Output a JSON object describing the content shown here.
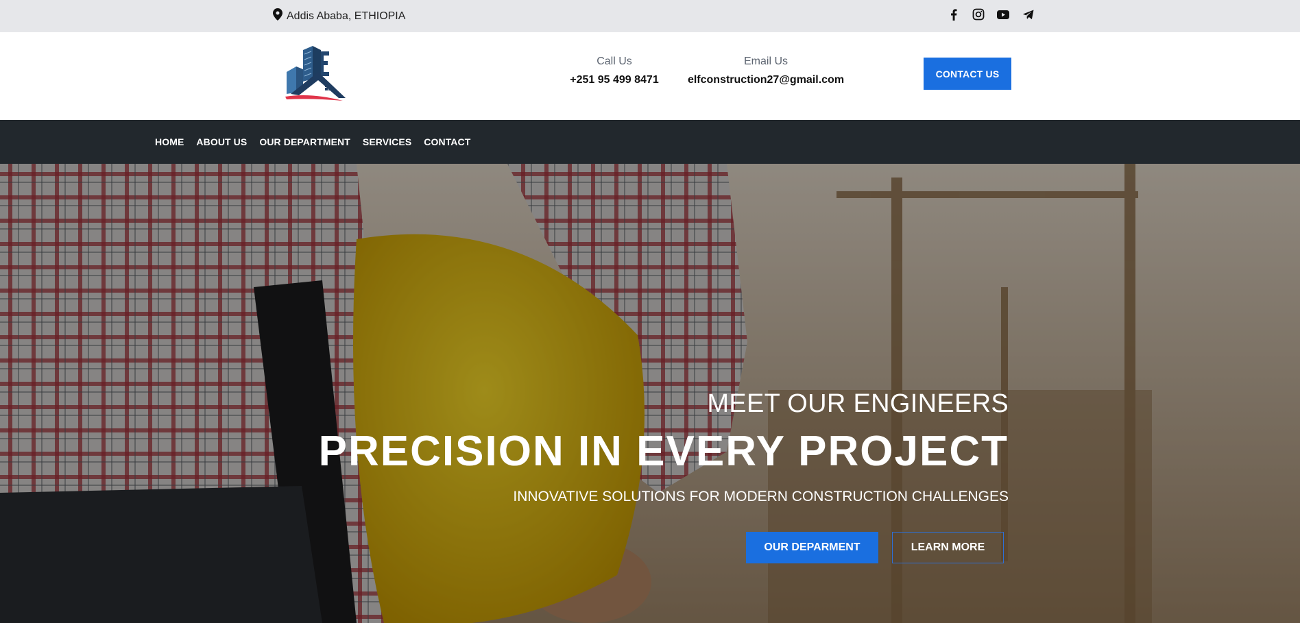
{
  "topbar": {
    "location": "Addis Ababa, ETHIOPIA",
    "social_icons": [
      "facebook-icon",
      "instagram-icon",
      "youtube-icon",
      "telegram-icon"
    ]
  },
  "header": {
    "call_label": "Call Us",
    "call_value": "+251 95 499 8471",
    "email_label": "Email Us",
    "email_value": "elfconstruction27@gmail.com",
    "cta_label": "CONTACT US"
  },
  "nav": {
    "items": [
      "HOME",
      "ABOUT US",
      "OUR DEPARTMENT",
      "SERVICES",
      "CONTACT"
    ]
  },
  "hero": {
    "subtitle": "MEET OUR ENGINEERS",
    "headline": "PRECISION IN EVERY PROJECT",
    "tagline": "INNOVATIVE SOLUTIONS FOR MODERN CONSTRUCTION CHALLENGES",
    "primary_button": "OUR DEPARMENT",
    "secondary_button": "LEARN MORE"
  },
  "colors": {
    "accent": "#1a6fe0",
    "nav_bg": "#22282d",
    "topbar_bg": "#e6e7ea"
  }
}
